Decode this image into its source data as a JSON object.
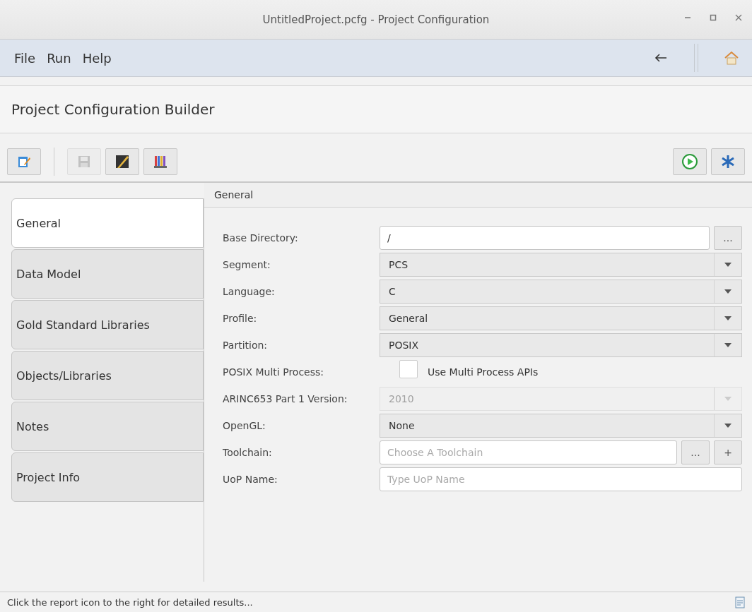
{
  "window": {
    "title": "UntitledProject.pcfg - Project Configuration"
  },
  "menu": [
    "File",
    "Run",
    "Help"
  ],
  "header": "Project Configuration Builder",
  "toolbar_left": [
    {
      "kind": "edit",
      "disabled": false
    },
    {
      "kind": "save",
      "disabled": true
    },
    {
      "kind": "build",
      "disabled": false
    },
    {
      "kind": "library",
      "disabled": false
    }
  ],
  "toolbar_right": [
    {
      "kind": "run",
      "disabled": false
    },
    {
      "kind": "network",
      "disabled": false
    }
  ],
  "tabs": [
    {
      "label": "General",
      "selected": true
    },
    {
      "label": "Data Model",
      "selected": false
    },
    {
      "label": "Gold Standard Libraries",
      "selected": false
    },
    {
      "label": "Objects/Libraries",
      "selected": false
    },
    {
      "label": "Notes",
      "selected": false
    },
    {
      "label": "Project Info",
      "selected": false
    }
  ],
  "panel_title": "General",
  "fields": [
    {
      "kind": "text",
      "label": "Base Directory:",
      "value": "/",
      "buttons": [
        "..."
      ]
    },
    {
      "kind": "select",
      "label": "Segment:",
      "value": "PCS",
      "disabled": false
    },
    {
      "kind": "select",
      "label": "Language:",
      "value": "C",
      "disabled": false
    },
    {
      "kind": "select",
      "label": "Profile:",
      "value": "General",
      "disabled": false
    },
    {
      "kind": "select",
      "label": "Partition:",
      "value": "POSIX",
      "disabled": false
    },
    {
      "kind": "checkbox",
      "label": "POSIX Multi Process:",
      "option": "Use Multi Process APIs",
      "checked": false
    },
    {
      "kind": "select",
      "label": "ARINC653 Part 1 Version:",
      "value": "2010",
      "disabled": true
    },
    {
      "kind": "select",
      "label": "OpenGL:",
      "value": "None",
      "disabled": false
    },
    {
      "kind": "text",
      "label": "Toolchain:",
      "placeholder": "Choose A Toolchain",
      "buttons": [
        "...",
        "+"
      ]
    },
    {
      "kind": "text",
      "label": "UoP Name:",
      "placeholder": "Type UoP Name"
    }
  ],
  "status_bar": "Click the report icon to the right for detailed results..."
}
